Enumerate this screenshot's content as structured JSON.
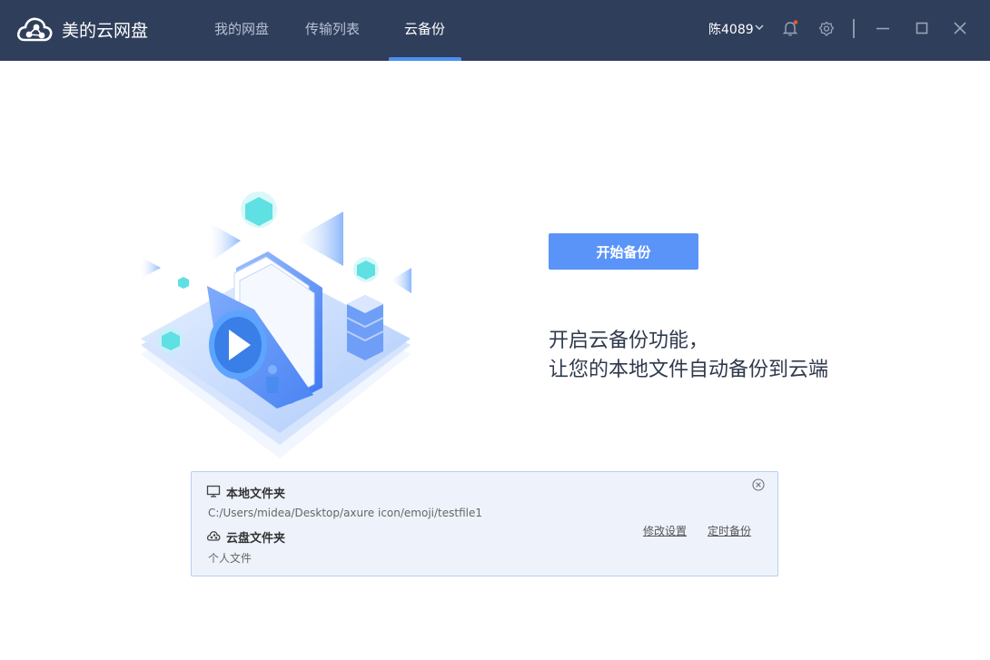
{
  "app": {
    "title": "美的云网盘"
  },
  "tabs": [
    {
      "label": "我的网盘"
    },
    {
      "label": "传输列表"
    },
    {
      "label": "云备份"
    }
  ],
  "user": {
    "name": "陈4089"
  },
  "colors": {
    "titlebar_bg": "#2f3e5b",
    "accent": "#5b94f8",
    "tab_indicator": "#4a90f0",
    "notification_dot": "#f05a28",
    "panel_bg": "#eef3fb"
  },
  "icons": {
    "logo": "cloud-network-icon",
    "user_dropdown": "chevron-down-icon",
    "notifications": "bell-icon",
    "settings": "gear-icon",
    "minimize": "minimize-icon",
    "maximize": "maximize-icon",
    "close": "close-icon"
  },
  "main": {
    "start_button": "开始备份",
    "description_line1": "开启云备份功能，",
    "description_line2": "让您的本地文件自动备份到云端"
  },
  "panel": {
    "local_folder_label": "本地文件夹",
    "local_folder_path": "C:/Users/midea/Desktop/axure icon/emoji/testfile1",
    "cloud_folder_label": "云盘文件夹",
    "cloud_folder_path": "个人文件",
    "modify_settings_link": "修改设置",
    "scheduled_backup_link": "定时备份"
  }
}
